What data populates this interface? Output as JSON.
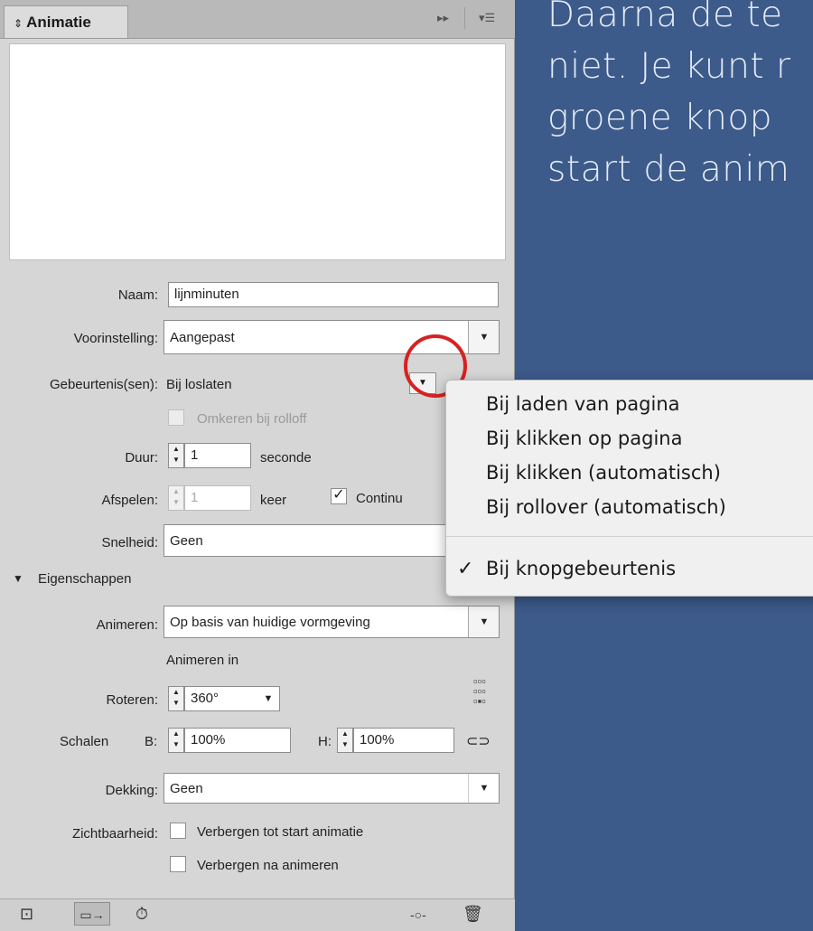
{
  "background_text": [
    "Daarna de te",
    "niet. Je kunt r",
    "groene knop",
    "start de anim"
  ],
  "panel": {
    "title": "Animatie",
    "naam_label": "Naam:",
    "naam_value": "lijnminuten",
    "voorinstelling_label": "Voorinstelling:",
    "voorinstelling_value": "Aangepast",
    "gebeurtenis_label": "Gebeurtenis(sen):",
    "gebeurtenis_value": "Bij loslaten",
    "omkeren_label": "Omkeren bij rolloff",
    "duur_label": "Duur:",
    "duur_value": "1",
    "duur_unit": "seconde",
    "afspelen_label": "Afspelen:",
    "afspelen_value": "1",
    "afspelen_unit": "keer",
    "continu_label": "Continu",
    "snelheid_label": "Snelheid:",
    "snelheid_value": "Geen",
    "eigenschappen_label": "Eigenschappen",
    "animeren_label": "Animeren:",
    "animeren_value": "Op basis van huidige vormgeving",
    "animeren_in_label": "Animeren in",
    "roteren_label": "Roteren:",
    "roteren_value": "360°",
    "schalen_label": "Schalen",
    "b_label": "B:",
    "b_value": "100%",
    "h_label": "H:",
    "h_value": "100%",
    "dekking_label": "Dekking:",
    "dekking_value": "Geen",
    "zichtbaarheid_label": "Zichtbaarheid:",
    "verbergen_start_label": "Verbergen tot start animatie",
    "verbergen_na_label": "Verbergen na animeren"
  },
  "menu": {
    "items": [
      "Bij laden van pagina",
      "Bij klikken op pagina",
      "Bij klikken (automatisch)",
      "Bij rollover (automatisch)"
    ],
    "checked_item": "Bij knopgebeurtenis",
    "check_mark": "✓"
  }
}
